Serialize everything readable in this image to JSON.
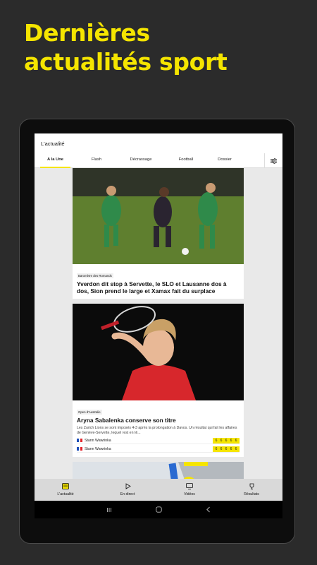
{
  "hero": {
    "line1": "Dernières",
    "line2": "actualités sport"
  },
  "app": {
    "title": "L'actualité"
  },
  "tabs": [
    {
      "label": "A la Une",
      "active": true
    },
    {
      "label": "Flash"
    },
    {
      "label": "Décrassage"
    },
    {
      "label": "Football"
    },
    {
      "label": "Dossier"
    }
  ],
  "settings_icon": "filter-sliders-icon",
  "cards": [
    {
      "kicker": "Baromètre des Romands",
      "headline": "Yverdon dit stop à Servette, le SLO et Lausanne dos à dos, Sion prend le large et Xamax fait du surplace",
      "image": "football-match-photo"
    },
    {
      "kicker": "Open d'Australie",
      "headline": "Aryna Sabalenka conserve son titre",
      "summary": "Les Zurich Lions se sont imposés 4-3 après la prolongation à Davos. Un résultat qui fait les affaires de Genève-Servette, lequel rest en tê...",
      "image": "tennis-player-photo",
      "scores": [
        {
          "player": "Stann Wawrinka",
          "sets": [
            "6",
            "6",
            "6",
            "6",
            "6"
          ]
        },
        {
          "player": "Stann Wawrinka",
          "sets": [
            "6",
            "6",
            "6",
            "6",
            "6"
          ]
        }
      ]
    },
    {
      "image": "ski-racer-photo"
    }
  ],
  "nav": [
    {
      "label": "L'actualité",
      "icon": "news-icon",
      "active": true
    },
    {
      "label": "En direct",
      "icon": "play-icon"
    },
    {
      "label": "Vidéos",
      "icon": "video-icon"
    },
    {
      "label": "Résultats",
      "icon": "trophy-icon"
    }
  ],
  "system": {
    "recents": "recents-icon",
    "home": "home-icon",
    "back": "back-icon"
  },
  "colors": {
    "accent": "#f5e500",
    "background": "#2b2b2b",
    "france_blue": "#1d4fb8",
    "france_red": "#e1262b"
  }
}
